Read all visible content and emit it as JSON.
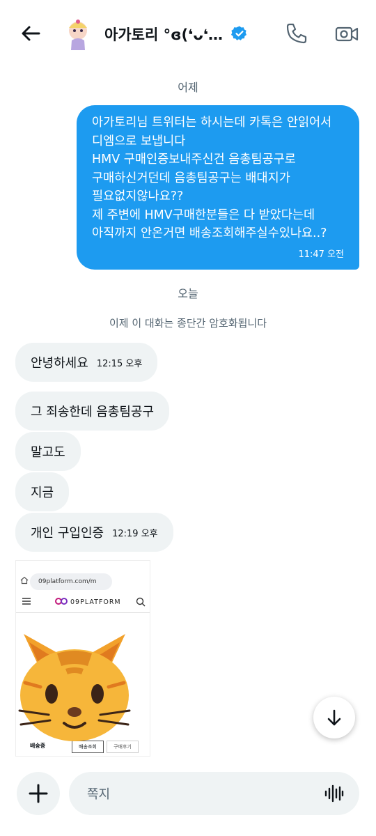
{
  "header": {
    "title": "아가토리 °ɞ(❛ᴗ❛…",
    "back_icon": "arrow-left-icon",
    "verified_icon": "verified-badge-icon",
    "phone_icon": "phone-icon",
    "video_icon": "video-camera-icon",
    "verified_color": "#1d9bf0"
  },
  "dividers": {
    "yesterday": "어제",
    "today": "오늘",
    "encryption_notice": "이제 이 대화는 종단간 암호화됩니다"
  },
  "outgoing_message": {
    "lines": [
      "아가토리님 트위터는 하시는데 카톡은 안읽어서",
      "디엠으로 보냅니다",
      "HMV 구매인증보내주신건 음총팀공구로",
      "구매하신거던데 음총팀공구는 배대지가",
      "필요없지않나요??",
      "제 주변에 HMV구매한분들은 다 받았다는데",
      "아직까지 안온거면 배송조회해주실수있나요..?"
    ],
    "time": "11:47 오전",
    "color": "#1d9bf0"
  },
  "incoming_messages": [
    {
      "text": "안녕하세요",
      "time": "12:15 오후"
    },
    {
      "text": "그 죄송한데 음총팀공구",
      "time": ""
    },
    {
      "text": "말고도",
      "time": ""
    },
    {
      "text": "지금",
      "time": ""
    },
    {
      "text": "개인 구입인증",
      "time": "12:19 오후"
    }
  ],
  "attachment": {
    "url_text": "09platform.com/m",
    "brand": "09PLATFORM",
    "status_label": "배송중",
    "tab_active": "배송조회",
    "tab_other": "구매후기",
    "sticker_icon": "cat-face-emoji-icon"
  },
  "composer": {
    "placeholder": "쪽지",
    "plus_icon": "plus-icon",
    "voice_icon": "voice-waveform-icon"
  },
  "scroll_icon": "arrow-down-icon"
}
